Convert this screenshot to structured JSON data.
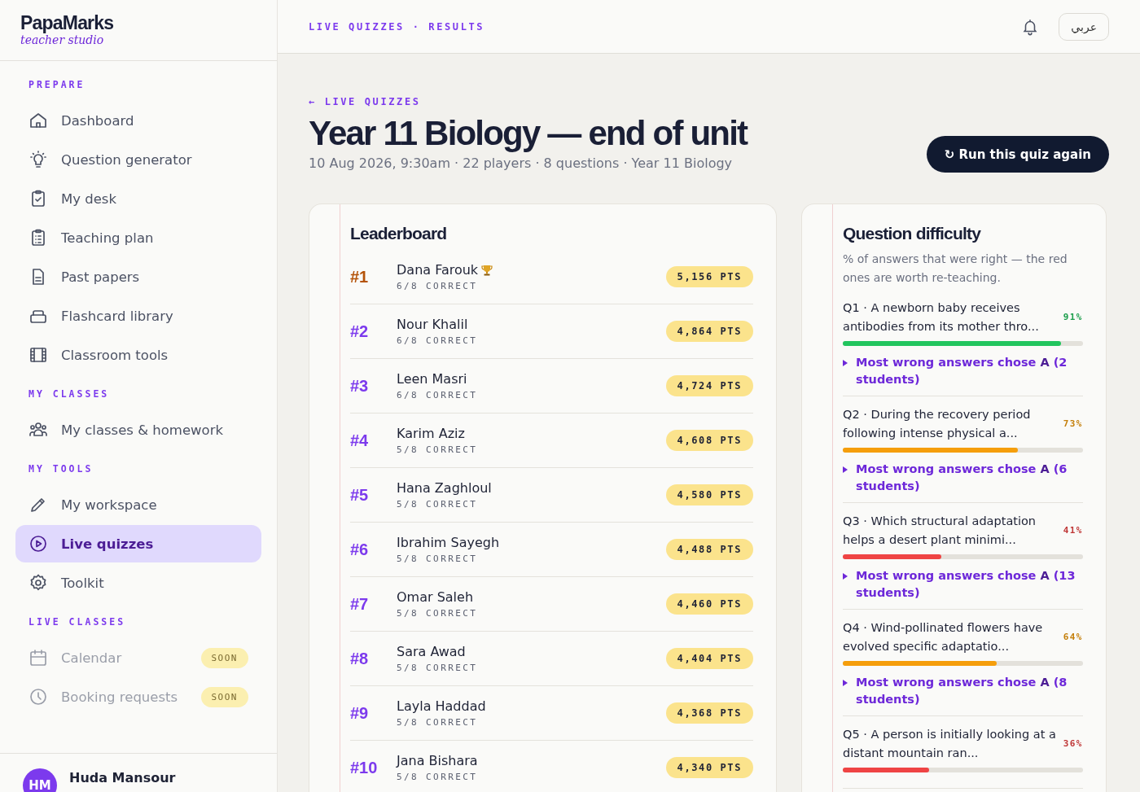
{
  "brand": {
    "name": "PapaMarks",
    "tagline": "teacher studio"
  },
  "sidebar": {
    "sections": [
      {
        "title": "PREPARE",
        "items": [
          {
            "label": "Dashboard",
            "selected": false,
            "disabled": false
          },
          {
            "label": "Question generator",
            "selected": false,
            "disabled": false
          },
          {
            "label": "My desk",
            "selected": false,
            "disabled": false
          },
          {
            "label": "Teaching plan",
            "selected": false,
            "disabled": false
          },
          {
            "label": "Past papers",
            "selected": false,
            "disabled": false
          },
          {
            "label": "Flashcard library",
            "selected": false,
            "disabled": false
          },
          {
            "label": "Classroom tools",
            "selected": false,
            "disabled": false
          }
        ]
      },
      {
        "title": "MY CLASSES",
        "items": [
          {
            "label": "My classes & homework",
            "selected": false,
            "disabled": false
          }
        ]
      },
      {
        "title": "MY TOOLS",
        "items": [
          {
            "label": "My workspace",
            "selected": false,
            "disabled": false
          },
          {
            "label": "Live quizzes",
            "selected": true,
            "disabled": false
          },
          {
            "label": "Toolkit",
            "selected": false,
            "disabled": false
          }
        ]
      },
      {
        "title": "LIVE CLASSES",
        "items": [
          {
            "label": "Calendar",
            "selected": false,
            "disabled": true,
            "badge": "SOON"
          },
          {
            "label": "Booking requests",
            "selected": false,
            "disabled": true,
            "badge": "SOON"
          }
        ]
      }
    ],
    "user": {
      "initials": "HM",
      "name": "Huda Mansour"
    }
  },
  "topbar": {
    "breadcrumb": "LIVE QUIZZES · RESULTS",
    "language": "عربي"
  },
  "header": {
    "back": "← LIVE QUIZZES",
    "title": "Year 11 Biology — end of unit",
    "meta": "10 Aug 2026, 9:30am · 22 players · 8 questions · Year 11 Biology",
    "action": "↻ Run this quiz again"
  },
  "leaderboard": {
    "title": "Leaderboard",
    "rows": [
      {
        "rank": "#1",
        "name": "Dana Farouk",
        "top": true,
        "correct": "6/8 CORRECT",
        "points": "5,156 PTS"
      },
      {
        "rank": "#2",
        "name": "Nour Khalil",
        "top": false,
        "correct": "6/8 CORRECT",
        "points": "4,864 PTS"
      },
      {
        "rank": "#3",
        "name": "Leen Masri",
        "top": false,
        "correct": "6/8 CORRECT",
        "points": "4,724 PTS"
      },
      {
        "rank": "#4",
        "name": "Karim Aziz",
        "top": false,
        "correct": "5/8 CORRECT",
        "points": "4,608 PTS"
      },
      {
        "rank": "#5",
        "name": "Hana Zaghloul",
        "top": false,
        "correct": "5/8 CORRECT",
        "points": "4,580 PTS"
      },
      {
        "rank": "#6",
        "name": "Ibrahim Sayegh",
        "top": false,
        "correct": "5/8 CORRECT",
        "points": "4,488 PTS"
      },
      {
        "rank": "#7",
        "name": "Omar Saleh",
        "top": false,
        "correct": "5/8 CORRECT",
        "points": "4,460 PTS"
      },
      {
        "rank": "#8",
        "name": "Sara Awad",
        "top": false,
        "correct": "5/8 CORRECT",
        "points": "4,404 PTS"
      },
      {
        "rank": "#9",
        "name": "Layla Haddad",
        "top": false,
        "correct": "5/8 CORRECT",
        "points": "4,368 PTS"
      },
      {
        "rank": "#10",
        "name": "Jana Bishara",
        "top": false,
        "correct": "5/8 CORRECT",
        "points": "4,340 PTS"
      }
    ]
  },
  "difficulty": {
    "title": "Question difficulty",
    "subtitle": "% of answers that were right — the red ones are worth re-teaching.",
    "questions": [
      {
        "text": "Q1 · A newborn baby receives antibodies from its mother thro...",
        "percent": "91%",
        "level": 0.91,
        "color": "#22c55e",
        "hint": "Most wrong answers chose **A** (2 students)"
      },
      {
        "text": "Q2 · During the recovery period following intense physical a...",
        "percent": "73%",
        "level": 0.73,
        "color": "#f59e0b",
        "hint": "Most wrong answers chose **A** (6 students)"
      },
      {
        "text": "Q3 · Which structural adaptation helps a desert plant minimi...",
        "percent": "41%",
        "level": 0.41,
        "color": "#ef4444",
        "hint": "Most wrong answers chose **A** (13 students)"
      },
      {
        "text": "Q4 · Wind-pollinated flowers have evolved specific adaptatio...",
        "percent": "64%",
        "level": 0.64,
        "color": "#f59e0b",
        "hint": "Most wrong answers chose **A** (8 students)"
      },
      {
        "text": "Q5 · A person is initially looking at a distant mountain ran...",
        "percent": "36%",
        "level": 0.36,
        "color": "#ef4444"
      }
    ]
  }
}
